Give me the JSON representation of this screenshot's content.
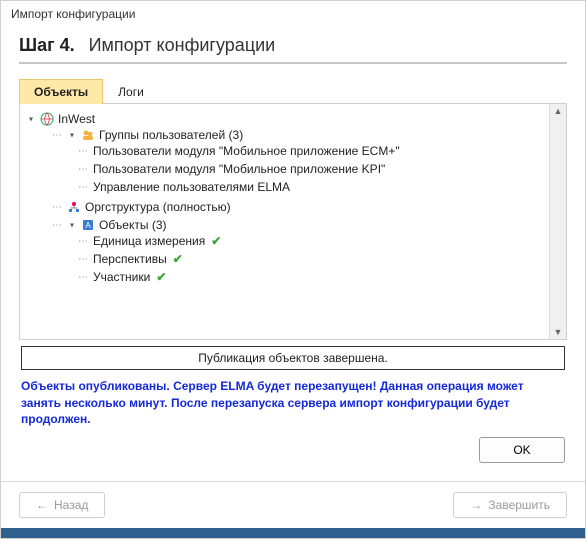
{
  "colors": {
    "accent_blue": "#1428d8",
    "tab_active_bg": "#ffe9a8",
    "check_green": "#3aa53a"
  },
  "window_title": "Импорт конфигурации",
  "step": {
    "number_label": "Шаг 4.",
    "title": "Импорт конфигурации"
  },
  "tabs": {
    "objects": "Объекты",
    "logs": "Логи",
    "active": "objects"
  },
  "tree": {
    "root": {
      "label": "InWest",
      "icon": "globe-icon"
    },
    "groups": {
      "label": "Группы пользователей",
      "count": "(3)",
      "children": [
        "Пользователи модуля \"Мобильное приложение ECM+\"",
        "Пользователи модуля \"Мобильное приложение KPI\"",
        "Управление пользователями ELMA"
      ]
    },
    "org": {
      "label": "Оргструктура (полностью)"
    },
    "objects": {
      "label": "Объекты",
      "count": "(3)",
      "children": [
        {
          "label": "Единица измерения",
          "done": true
        },
        {
          "label": "Перспективы",
          "done": true
        },
        {
          "label": "Участники",
          "done": true
        }
      ]
    }
  },
  "status_text": "Публикация объектов завершена.",
  "notice_text": "Объекты опубликованы. Сервер ELMA будет перезапущен! Данная операция может занять несколько минут. После перезапуска сервера импорт конфигурации будет продолжен.",
  "buttons": {
    "ok": "OK",
    "back": "Назад",
    "finish": "Завершить"
  }
}
